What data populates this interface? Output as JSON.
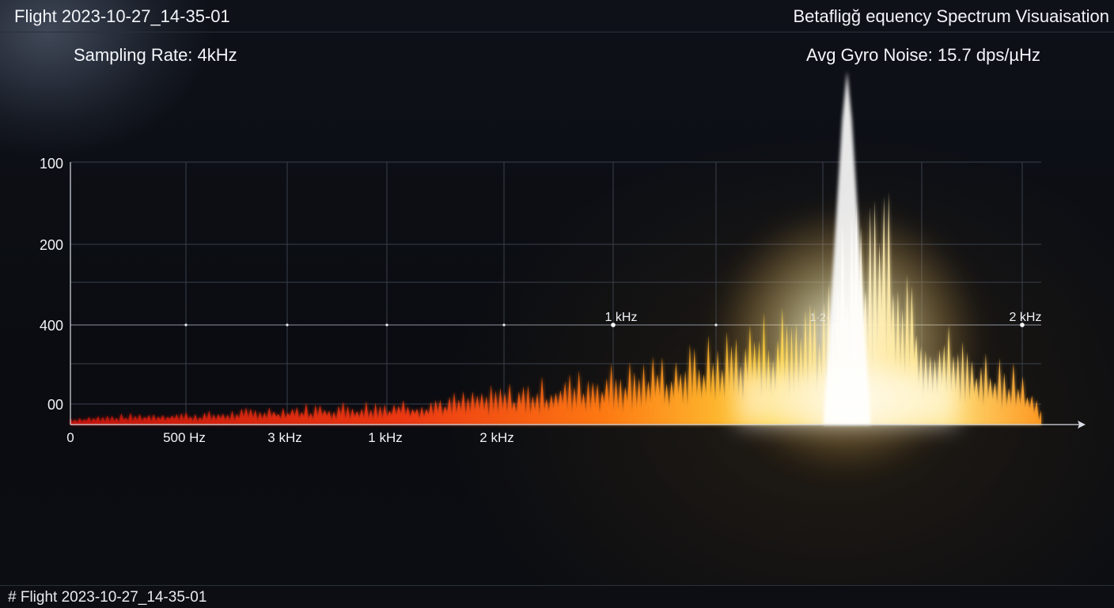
{
  "header": {
    "flight_name": "Flight 2023-10-27_14-35-01",
    "app_title": "Betafligğ equency Spectrum Visuaisation"
  },
  "stats": {
    "sampling_rate": "Sampling Rate: 4kHz",
    "avg_gyro_noise": "Avg Gyro Noise: 15.7 dps/µHz"
  },
  "footer": {
    "label": "# Flight 2023-10-27_14-35-01"
  },
  "colors": {
    "background": "#0b0d12",
    "grid": "#3a404b",
    "axis": "#d9dde5",
    "spectrum_low": "#d81e10",
    "spectrum_mid": "#ff7a12",
    "spectrum_high": "#ffd23a",
    "spectrum_peak": "#ffffff"
  },
  "chart_data": {
    "type": "area",
    "title": "",
    "xlabel": "",
    "ylabel": "",
    "grid": true,
    "x_tick_labels": [
      "0",
      "500 Hz",
      "3 kHz",
      "1 kHz",
      "2 kHz"
    ],
    "inline_markers": [
      "1 kHz",
      "1·2·1",
      "2 kHz"
    ],
    "y_tick_labels": [
      "100",
      "200",
      "400",
      "00"
    ],
    "x_range": [
      0,
      1
    ],
    "y_range": [
      0,
      1
    ],
    "series": [
      {
        "x": [
          0.0,
          0.05,
          0.1,
          0.15,
          0.2,
          0.25,
          0.3,
          0.35,
          0.4,
          0.45,
          0.5,
          0.55,
          0.6,
          0.63,
          0.66,
          0.69,
          0.72,
          0.75,
          0.78,
          0.8,
          0.82,
          0.84,
          0.86,
          0.88,
          0.9,
          0.92,
          0.94,
          0.96,
          0.98,
          1.0
        ],
        "y": [
          0.03,
          0.04,
          0.05,
          0.05,
          0.07,
          0.08,
          0.09,
          0.1,
          0.12,
          0.15,
          0.18,
          0.22,
          0.25,
          0.28,
          0.32,
          0.38,
          0.42,
          0.48,
          0.6,
          0.75,
          0.92,
          1.0,
          0.72,
          0.45,
          0.38,
          0.32,
          0.28,
          0.26,
          0.24,
          0.05
        ]
      }
    ]
  }
}
